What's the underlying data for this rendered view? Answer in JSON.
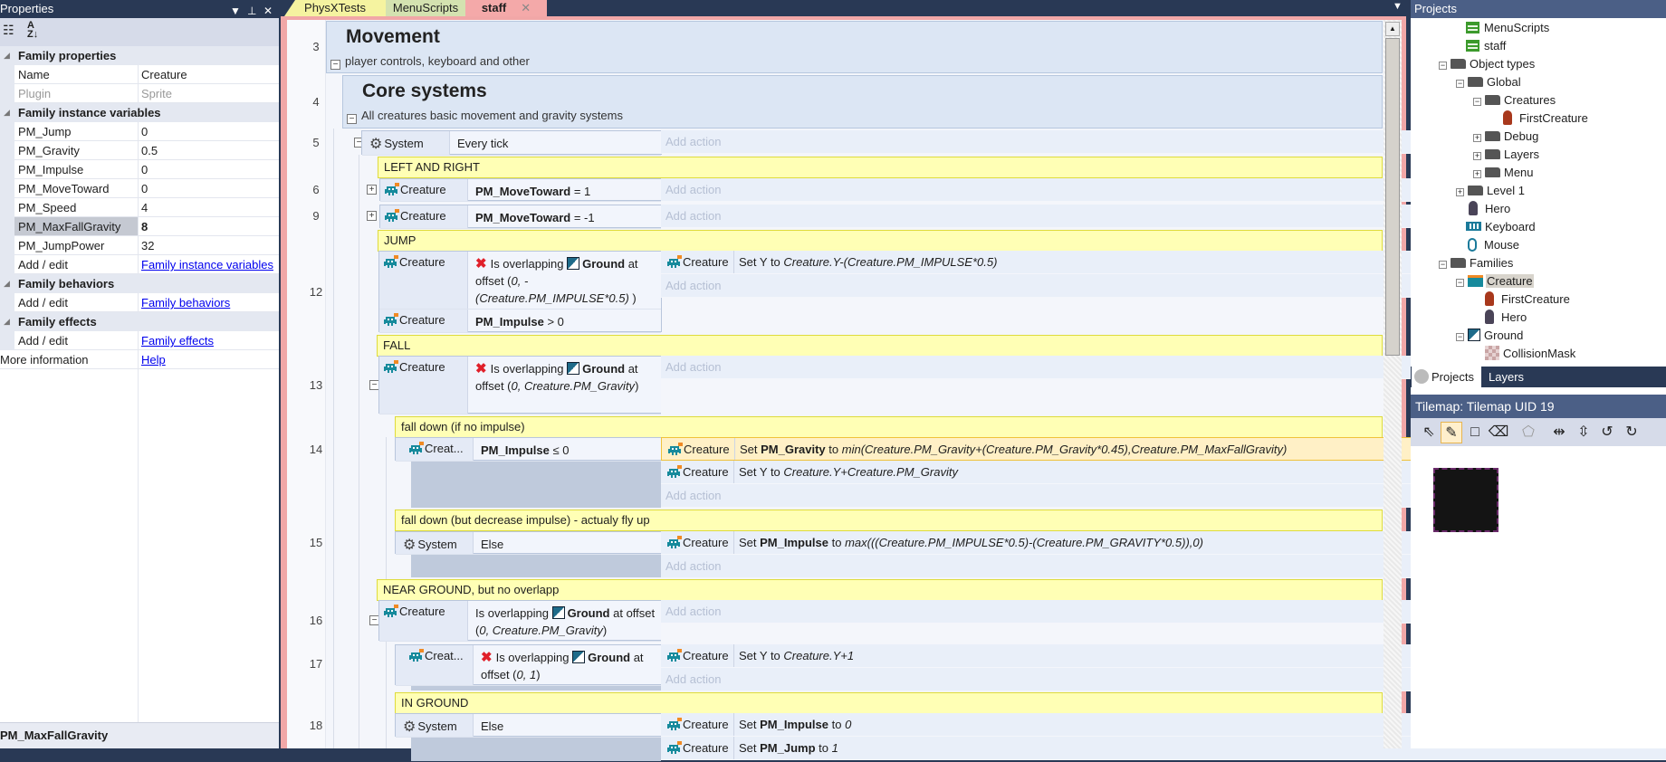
{
  "properties": {
    "title": "Properties",
    "groups": [
      {
        "label": "Family properties",
        "rows": [
          {
            "key": "Name",
            "value": "Creature"
          },
          {
            "key": "Plugin",
            "value": "Sprite"
          }
        ]
      },
      {
        "label": "Family instance variables",
        "rows": [
          {
            "key": "PM_Jump",
            "value": "0"
          },
          {
            "key": "PM_Gravity",
            "value": "0.5"
          },
          {
            "key": "PM_Impulse",
            "value": "0"
          },
          {
            "key": "PM_MoveToward",
            "value": "0"
          },
          {
            "key": "PM_Speed",
            "value": "4"
          },
          {
            "key": "PM_MaxFallGravity",
            "value": "8"
          },
          {
            "key": "PM_JumpPower",
            "value": "32"
          },
          {
            "key": "Add / edit",
            "value": "Family instance variables"
          }
        ]
      },
      {
        "label": "Family behaviors",
        "rows": [
          {
            "key": "Add / edit",
            "value": "Family behaviors"
          }
        ]
      },
      {
        "label": "Family effects",
        "rows": [
          {
            "key": "Add / edit",
            "value": "Family effects"
          }
        ]
      }
    ],
    "more_info": {
      "key": "More information",
      "value": "Help"
    },
    "description": "PM_MaxFallGravity"
  },
  "tabs": [
    {
      "label": "PhysXTests",
      "color": "#f5f3a0"
    },
    {
      "label": "MenuScripts",
      "color": "#d4e2b0"
    },
    {
      "label": "staff",
      "color": "#f4a9a9"
    }
  ],
  "event_sheet": {
    "add_action": "Add action",
    "groups": [
      {
        "line": "3",
        "title": "Movement",
        "description": "player controls, keyboard and other"
      },
      {
        "line": "4",
        "title": "Core systems",
        "description": "All creatures basic movement and gravity systems"
      }
    ],
    "comments": [
      "LEFT AND RIGHT",
      "JUMP",
      "FALL",
      "fall down (if no impulse)",
      "fall down (but decrease impulse) - actualy fly up",
      "NEAR GROUND, but no overlapp",
      "IN GROUND"
    ],
    "events": [
      {
        "line": "5",
        "conditions": [
          {
            "object": "System",
            "parts": [
              [
                "Every tick",
                ""
              ]
            ]
          }
        ],
        "actions": []
      },
      {
        "line": "6",
        "conditions": [
          {
            "object": "Creature",
            "parts": [
              [
                "PM_MoveToward",
                "b"
              ],
              [
                " = 1",
                ""
              ]
            ]
          }
        ],
        "actions": []
      },
      {
        "line": "9",
        "conditions": [
          {
            "object": "Creature",
            "parts": [
              [
                "PM_MoveToward",
                "b"
              ],
              [
                " = -1",
                ""
              ]
            ]
          }
        ],
        "actions": []
      },
      {
        "line": "12",
        "conditions": [
          {
            "object": "Creature",
            "parts": [
              [
                "",
                "x"
              ],
              [
                "Is overlapping ",
                ""
              ],
              [
                "",
                "g"
              ],
              [
                "Ground",
                "b"
              ],
              [
                " at offset (",
                ""
              ],
              [
                "0, -(Creature.PM_IMPULSE*0.5)",
                "i"
              ],
              [
                " )",
                ""
              ]
            ]
          },
          {
            "object": "Creature",
            "parts": [
              [
                "PM_Impulse",
                "b"
              ],
              [
                " > 0",
                ""
              ]
            ]
          }
        ],
        "actions": [
          {
            "object": "Creature",
            "parts": [
              [
                "Set Y to ",
                ""
              ],
              [
                "Creature.Y-(Creature.PM_IMPULSE*0.5)",
                "i"
              ]
            ]
          }
        ]
      },
      {
        "line": "13",
        "conditions": [
          {
            "object": "Creature",
            "parts": [
              [
                "",
                "x"
              ],
              [
                "Is overlapping ",
                ""
              ],
              [
                "",
                "g"
              ],
              [
                "Ground",
                "b"
              ],
              [
                " at offset (",
                ""
              ],
              [
                "0, Creature.PM_Gravity",
                "i"
              ],
              [
                ")",
                ""
              ]
            ]
          }
        ],
        "actions": []
      },
      {
        "line": "14",
        "conditions": [
          {
            "object": "Creat...",
            "parts": [
              [
                "PM_Impulse",
                "b"
              ],
              [
                " ≤ 0",
                ""
              ]
            ]
          }
        ],
        "actions": [
          {
            "object": "Creature",
            "parts": [
              [
                "Set ",
                ""
              ],
              [
                "PM_Gravity",
                "b"
              ],
              [
                " to ",
                ""
              ],
              [
                "min(Creature.PM_Gravity+(Creature.PM_Gravity*0.45),Creature.PM_MaxFallGravity)",
                "i"
              ]
            ]
          },
          {
            "object": "Creature",
            "parts": [
              [
                "Set Y to ",
                ""
              ],
              [
                "Creature.Y+Creature.PM_Gravity",
                "i"
              ]
            ]
          }
        ]
      },
      {
        "line": "15",
        "conditions": [
          {
            "object": "System",
            "parts": [
              [
                "Else",
                ""
              ]
            ]
          }
        ],
        "actions": [
          {
            "object": "Creature",
            "parts": [
              [
                "Set ",
                ""
              ],
              [
                "PM_Impulse",
                "b"
              ],
              [
                " to ",
                ""
              ],
              [
                "max(((Creature.PM_IMPULSE*0.5)-(Creature.PM_GRAVITY*0.5)),0)",
                "i"
              ]
            ]
          }
        ]
      },
      {
        "line": "16",
        "conditions": [
          {
            "object": "Creature",
            "parts": [
              [
                "Is overlapping ",
                ""
              ],
              [
                "",
                "g"
              ],
              [
                "Ground",
                "b"
              ],
              [
                " at offset (",
                ""
              ],
              [
                "0, Creature.PM_Gravity",
                "i"
              ],
              [
                ")",
                ""
              ]
            ]
          }
        ],
        "actions": []
      },
      {
        "line": "17",
        "conditions": [
          {
            "object": "Creat...",
            "parts": [
              [
                "",
                "x"
              ],
              [
                "Is overlapping ",
                ""
              ],
              [
                "",
                "g"
              ],
              [
                "Ground",
                "b"
              ],
              [
                " at offset (",
                ""
              ],
              [
                "0, 1",
                "i"
              ],
              [
                ")",
                ""
              ]
            ]
          }
        ],
        "actions": [
          {
            "object": "Creature",
            "parts": [
              [
                "Set Y to ",
                ""
              ],
              [
                "Creature.Y+1",
                "i"
              ]
            ]
          }
        ]
      },
      {
        "line": "18",
        "conditions": [
          {
            "object": "System",
            "parts": [
              [
                "Else",
                ""
              ]
            ]
          }
        ],
        "actions": [
          {
            "object": "Creature",
            "parts": [
              [
                "Set ",
                ""
              ],
              [
                "PM_Impulse",
                "b"
              ],
              [
                " to ",
                ""
              ],
              [
                "0",
                "i"
              ]
            ]
          },
          {
            "object": "Creature",
            "parts": [
              [
                "Set ",
                ""
              ],
              [
                "PM_Jump",
                "b"
              ],
              [
                " to ",
                ""
              ],
              [
                "1",
                "i"
              ]
            ]
          }
        ]
      }
    ]
  },
  "projects": {
    "title": "Projects",
    "tree": [
      {
        "label": "MenuScripts",
        "icon": "event-sheet"
      },
      {
        "label": "staff",
        "icon": "event-sheet"
      },
      {
        "label": "Object types",
        "icon": "folder",
        "toggle": "−"
      },
      {
        "label": "Global",
        "icon": "folder",
        "toggle": "−"
      },
      {
        "label": "Creatures",
        "icon": "folder",
        "toggle": "−"
      },
      {
        "label": "FirstCreature",
        "icon": "sprite-red"
      },
      {
        "label": "Debug",
        "icon": "folder",
        "toggle": "+"
      },
      {
        "label": "Layers",
        "icon": "folder",
        "toggle": "+"
      },
      {
        "label": "Menu",
        "icon": "folder",
        "toggle": "+"
      },
      {
        "label": "Level 1",
        "icon": "folder",
        "toggle": "+"
      },
      {
        "label": "Hero",
        "icon": "sprite-dark"
      },
      {
        "label": "Keyboard",
        "icon": "keyboard"
      },
      {
        "label": "Mouse",
        "icon": "mouse"
      },
      {
        "label": "Families",
        "icon": "folder",
        "toggle": "−"
      },
      {
        "label": "Creature",
        "icon": "family",
        "toggle": "−"
      },
      {
        "label": "FirstCreature",
        "icon": "sprite-red"
      },
      {
        "label": "Hero",
        "icon": "sprite-dark"
      },
      {
        "label": "Ground",
        "icon": "tiled",
        "toggle": "−"
      },
      {
        "label": "CollisionMask",
        "icon": "mask"
      }
    ],
    "tabs": [
      "Projects",
      "Layers"
    ],
    "tilemap_title": "Tilemap: Tilemap UID 19"
  }
}
